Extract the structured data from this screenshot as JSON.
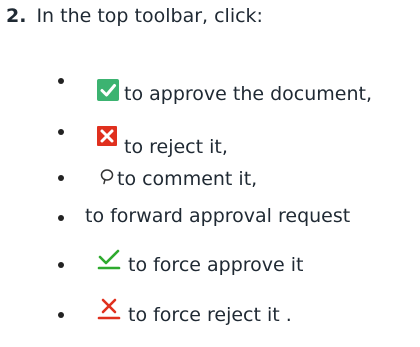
{
  "step": {
    "number": "2.",
    "text": "In the top toolbar, click:"
  },
  "items": [
    {
      "icon": "approve-check-icon",
      "text": "to approve the document,"
    },
    {
      "icon": "reject-x-icon",
      "text": "to reject it,"
    },
    {
      "icon": "comment-bubble-icon",
      "text": "to comment it,"
    },
    {
      "icon": "",
      "text": "to forward approval request"
    },
    {
      "icon": "force-approve-check-icon",
      "text": "to force approve it"
    },
    {
      "icon": "force-reject-x-icon",
      "text": "to force reject it ."
    }
  ],
  "colors": {
    "approve_bg": "#3cb371",
    "reject_bg": "#e0301e",
    "force_approve": "#2eaa2e",
    "force_reject": "#e0301e"
  }
}
